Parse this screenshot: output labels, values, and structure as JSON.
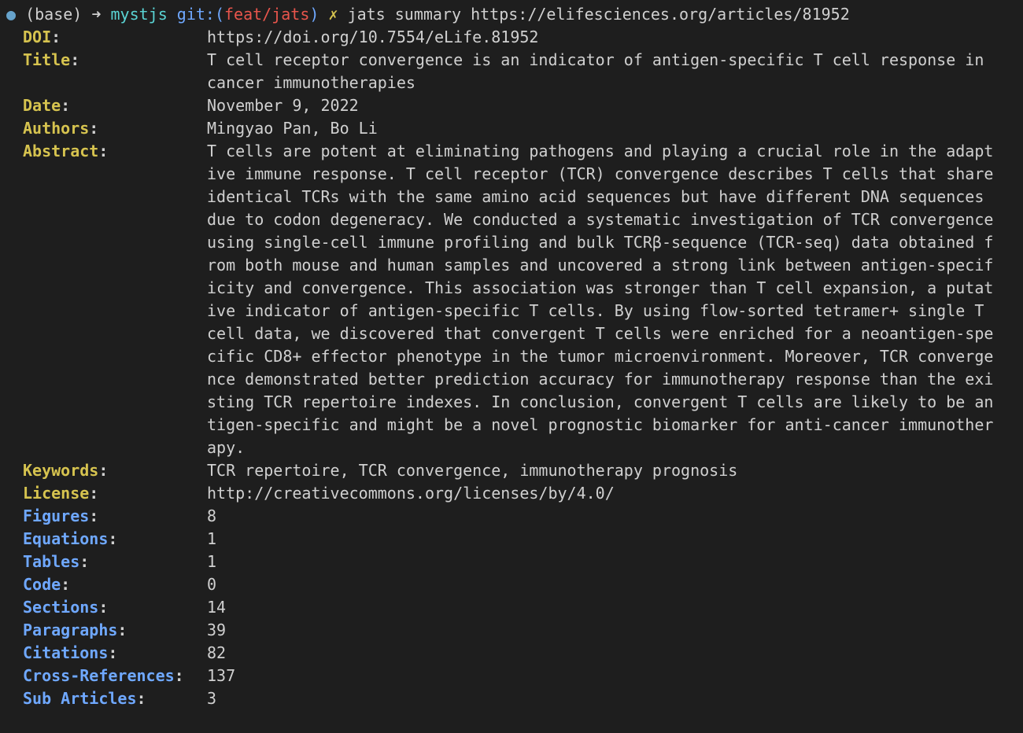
{
  "prompt": {
    "bullet": "●",
    "base": "(base)",
    "arrow": "➜ ",
    "dir": "mystjs",
    "git_label": "git:(",
    "branch": "feat/jats",
    "paren_close": ")",
    "dirty": "✗",
    "command": "jats summary https://elifesciences.org/articles/81952"
  },
  "fields": {
    "doi": {
      "label": "DOI",
      "value": "https://doi.org/10.7554/eLife.81952"
    },
    "title": {
      "label": "Title",
      "value": "T cell receptor convergence is an indicator of antigen-specific T cell response in cancer immunotherapies"
    },
    "date": {
      "label": "Date",
      "value": "November 9, 2022"
    },
    "authors": {
      "label": "Authors",
      "value": "Mingyao Pan, Bo Li"
    },
    "abstract": {
      "label": "Abstract",
      "value": "T cells are potent at eliminating pathogens and playing a crucial role in the adaptive immune response. T cell receptor (TCR) convergence describes T cells that share identical TCRs with the same amino acid sequences but have different DNA sequences due to codon degeneracy. We conducted a systematic investigation of TCR convergence using single-cell immune profiling and bulk TCRβ-sequence (TCR-seq) data obtained from both mouse and human samples and uncovered a strong link between antigen-specificity and convergence. This association was stronger than T cell expansion, a putative indicator of antigen-specific T cells. By using flow-sorted tetramer+ single T cell data, we discovered that convergent T cells were enriched for a neoantigen-specific CD8+ effector phenotype in the tumor microenvironment. Moreover, TCR convergence demonstrated better prediction accuracy for immunotherapy response than the existing TCR repertoire indexes. In conclusion, convergent T cells are likely to be antigen-specific and might be a novel prognostic biomarker for anti-cancer immunotherapy."
    },
    "keywords": {
      "label": "Keywords",
      "value": "TCR repertoire, TCR convergence, immunotherapy prognosis"
    },
    "license": {
      "label": "License",
      "value": "http://creativecommons.org/licenses/by/4.0/"
    },
    "figures": {
      "label": "Figures",
      "value": "8"
    },
    "equations": {
      "label": "Equations",
      "value": "1"
    },
    "tables": {
      "label": "Tables",
      "value": "1"
    },
    "code": {
      "label": "Code",
      "value": "0"
    },
    "sections": {
      "label": "Sections",
      "value": "14"
    },
    "paragraphs": {
      "label": "Paragraphs",
      "value": "39"
    },
    "citations": {
      "label": "Citations",
      "value": "82"
    },
    "crossrefs": {
      "label": "Cross-References",
      "value": "137"
    },
    "subarticles": {
      "label": "Sub Articles",
      "value": "3"
    }
  }
}
